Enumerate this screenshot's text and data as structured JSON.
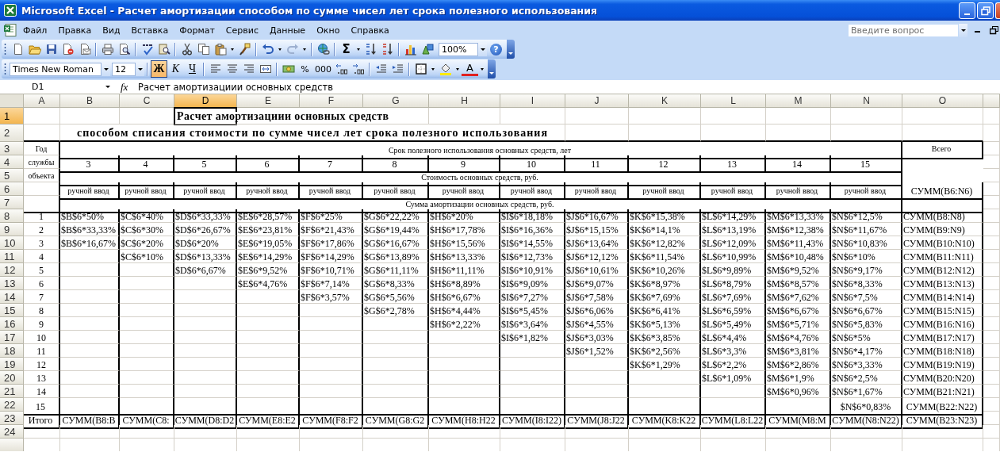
{
  "window": {
    "title": "Microsoft Excel - Расчет амортизации способом по сумме чисел лет срока полезного использования"
  },
  "menu": [
    "Файл",
    "Правка",
    "Вид",
    "Вставка",
    "Формат",
    "Сервис",
    "Данные",
    "Окно",
    "Справка"
  ],
  "help_box": {
    "placeholder": "Введите вопрос"
  },
  "standard_toolbar": {
    "sum": "Σ",
    "zoom": "100%",
    "help": "?"
  },
  "formatting_toolbar": {
    "font": "Times New Roman",
    "size": "12",
    "styles": [
      {
        "label": "Ж",
        "kind": "bold",
        "pressed": true
      },
      {
        "label": "К",
        "kind": "italic",
        "pressed": false
      },
      {
        "label": "Ч",
        "kind": "underline",
        "pressed": false
      }
    ],
    "number_formats": [
      "%",
      "000"
    ],
    "font_color": "A"
  },
  "formula_bar": {
    "cell": "D1",
    "function_label": "fx",
    "formula": "Расчет амортизациии основных средств"
  },
  "sheet": {
    "column_headers": [
      {
        "label": "A",
        "selected": false
      },
      {
        "label": "B",
        "selected": false
      },
      {
        "label": "C",
        "selected": false
      },
      {
        "label": "D",
        "selected": true
      },
      {
        "label": "E",
        "selected": false
      },
      {
        "label": "F",
        "selected": false
      },
      {
        "label": "G",
        "selected": false
      },
      {
        "label": "H",
        "selected": false
      },
      {
        "label": "I",
        "selected": false
      },
      {
        "label": "J",
        "selected": false
      },
      {
        "label": "K",
        "selected": false
      },
      {
        "label": "L",
        "selected": false
      },
      {
        "label": "M",
        "selected": false
      },
      {
        "label": "N",
        "selected": false
      },
      {
        "label": "O",
        "selected": false
      }
    ],
    "row_headers": [
      {
        "label": "1",
        "selected": true
      },
      {
        "label": "2",
        "selected": false
      },
      {
        "label": "3",
        "selected": false
      },
      {
        "label": "4",
        "selected": false
      },
      {
        "label": "5",
        "selected": false
      },
      {
        "label": "6",
        "selected": false
      },
      {
        "label": "7",
        "selected": false
      },
      {
        "label": "8",
        "selected": false
      },
      {
        "label": "9",
        "selected": false
      },
      {
        "label": "10",
        "selected": false
      },
      {
        "label": "11",
        "selected": false
      },
      {
        "label": "12",
        "selected": false
      },
      {
        "label": "13",
        "selected": false
      },
      {
        "label": "14",
        "selected": false
      },
      {
        "label": "15",
        "selected": false
      },
      {
        "label": "16",
        "selected": false
      },
      {
        "label": "17",
        "selected": false
      },
      {
        "label": "18",
        "selected": false
      },
      {
        "label": "19",
        "selected": false
      },
      {
        "label": "20",
        "selected": false
      },
      {
        "label": "21",
        "selected": false
      },
      {
        "label": "22",
        "selected": false
      },
      {
        "label": "23",
        "selected": false
      },
      {
        "label": "24",
        "selected": false
      }
    ],
    "title": "Расчет амортизациии основных средств",
    "subtitle": "способом списания стоимости по сумме чисел лет срока полезного использования",
    "table": {
      "year_label": [
        "Год",
        "службы",
        "объекта"
      ],
      "life_heading": "Срок полезного использования основных средств, лет",
      "cost_heading": "Стоимость основных средств, руб.",
      "depreciation_heading": "Сумма амортизации основных средств, руб.",
      "total_heading": "Всего",
      "cost_total": "СУММ(B6:N6)",
      "years": [
        "1",
        "2",
        "3",
        "4",
        "5",
        "6",
        "7",
        "8",
        "9",
        "10",
        "11",
        "12",
        "13",
        "14",
        "15"
      ],
      "row_totals": [
        "СУММ(B8:N8)",
        "СУММ(B9:N9)",
        "СУММ(B10:N10)",
        "СУММ(B11:N11)",
        "СУММ(B12:N12)",
        "СУММ(B13:N13)",
        "СУММ(B14:N14)",
        "СУММ(B15:N15)",
        "СУММ(B16:N16)",
        "СУММ(B17:N17)",
        "СУММ(B18:N18)",
        "СУММ(B19:N19)",
        "СУММ(B20:N20)",
        "СУММ(B21:N21)",
        "СУММ(B22:N22)"
      ],
      "totals_label": "Итого",
      "grand_total": "СУММ(B23:N23)",
      "columns": [
        {
          "life": "3",
          "input": "ручной ввод",
          "rates": [
            "$B$6*50%",
            "$B$6*33,33%",
            "$B$6*16,67%"
          ],
          "total": "СУММ(B8:B"
        },
        {
          "life": "4",
          "input": "ручной ввод",
          "rates": [
            "$C$6*40%",
            "$C$6*30%",
            "$C$6*20%",
            "$C$6*10%"
          ],
          "total": "СУММ(C8:"
        },
        {
          "life": "5",
          "input": "ручной ввод",
          "rates": [
            "$D$6*33,33%",
            "$D$6*26,67%",
            "$D$6*20%",
            "$D$6*13,33%",
            "$D$6*6,67%"
          ],
          "total": "СУММ(D8:D2"
        },
        {
          "life": "6",
          "input": "ручной ввод",
          "rates": [
            "$E$6*28,57%",
            "$E$6*23,81%",
            "$E$6*19,05%",
            "$E$6*14,29%",
            "$E$6*9,52%",
            "$E$6*4,76%"
          ],
          "total": "СУММ(E8:E2"
        },
        {
          "life": "7",
          "input": "ручной ввод",
          "rates": [
            "$F$6*25%",
            "$F$6*21,43%",
            "$F$6*17,86%",
            "$F$6*14,29%",
            "$F$6*10,71%",
            "$F$6*7,14%",
            "$F$6*3,57%"
          ],
          "total": "СУММ(F8:F2"
        },
        {
          "life": "8",
          "input": "ручной ввод",
          "rates": [
            "$G$6*22,22%",
            "$G$6*19,44%",
            "$G$6*16,67%",
            "$G$6*13,89%",
            "$G$6*11,11%",
            "$G$6*8,33%",
            "$G$6*5,56%",
            "$G$6*2,78%"
          ],
          "total": "СУММ(G8:G2"
        },
        {
          "life": "9",
          "input": "ручной ввод",
          "rates": [
            "$H$6*20%",
            "$H$6*17,78%",
            "$H$6*15,56%",
            "$H$6*13,33%",
            "$H$6*11,11%",
            "$H$6*8,89%",
            "$H$6*6,67%",
            "$H$6*4,44%",
            "$H$6*2,22%"
          ],
          "total": "СУММ(H8:H22"
        },
        {
          "life": "10",
          "input": "ручной ввод",
          "rates": [
            "$I$6*18,18%",
            "$I$6*16,36%",
            "$I$6*14,55%",
            "$I$6*12,73%",
            "$I$6*10,91%",
            "$I$6*9,09%",
            "$I$6*7,27%",
            "$I$6*5,45%",
            "$I$6*3,64%",
            "$I$6*1,82%"
          ],
          "total": "СУММ(I8:I22)"
        },
        {
          "life": "11",
          "input": "ручной ввод",
          "rates": [
            "$J$6*16,67%",
            "$J$6*15,15%",
            "$J$6*13,64%",
            "$J$6*12,12%",
            "$J$6*10,61%",
            "$J$6*9,07%",
            "$J$6*7,58%",
            "$J$6*6,06%",
            "$J$6*4,55%",
            "$J$6*3,03%",
            "$J$6*1,52%"
          ],
          "total": "СУММ(J8:J22"
        },
        {
          "life": "12",
          "input": "ручной ввод",
          "rates": [
            "$K$6*15,38%",
            "$K$6*14,1%",
            "$K$6*12,82%",
            "$K$6*11,54%",
            "$K$6*10,26%",
            "$K$6*8,97%",
            "$K$6*7,69%",
            "$K$6*6,41%",
            "$K$6*5,13%",
            "$K$6*3,85%",
            "$K$6*2,56%",
            "$K$6*1,29%"
          ],
          "total": "СУММ(K8:K22"
        },
        {
          "life": "13",
          "input": "ручной ввод",
          "rates": [
            "$L$6*14,29%",
            "$L$6*13,19%",
            "$L$6*12,09%",
            "$L$6*10,99%",
            "$L$6*9,89%",
            "$L$6*8,79%",
            "$L$6*7,69%",
            "$L$6*6,59%",
            "$L$6*5,49%",
            "$L$6*4,4%",
            "$L$6*3,3%",
            "$L$6*2,2%",
            "$L$6*1,09%"
          ],
          "total": "СУММ(L8:L22"
        },
        {
          "life": "14",
          "input": "ручной ввод",
          "rates": [
            "$M$6*13,33%",
            "$M$6*12,38%",
            "$M$6*11,43%",
            "$M$6*10,48%",
            "$M$6*9,52%",
            "$M$6*8,57%",
            "$M$6*7,62%",
            "$M$6*6,67%",
            "$M$6*5,71%",
            "$M$6*4,76%",
            "$M$6*3,81%",
            "$M$6*2,86%",
            "$M$6*1,9%",
            "$M$6*0,96%"
          ],
          "total": "СУММ(M8:M"
        },
        {
          "life": "15",
          "input": "ручной ввод",
          "rates": [
            "$N$6*12,5%",
            "$N$6*11,67%",
            "$N$6*10,83%",
            "$N$6*10%",
            "$N$6*9,17%",
            "$N$6*8,33%",
            "$N$6*7,5%",
            "$N$6*6,67%",
            "$N$6*5,83%",
            "$N$6*5%",
            "$N$6*4,17%",
            "$N$6*3,33%",
            "$N$6*2,5%",
            "$N$6*1,67%",
            "$N$6*0,83%"
          ],
          "total": "СУММ(N8:N22)"
        }
      ]
    }
  }
}
